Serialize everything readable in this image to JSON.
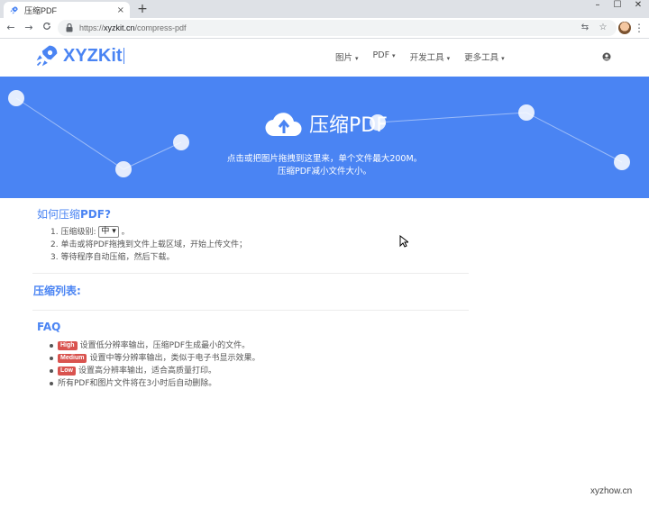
{
  "browser": {
    "tab_title": "压缩PDF",
    "tab_close": "×",
    "new_tab": "+",
    "window_controls": {
      "minimize": "–",
      "maximize": "☐",
      "close": "✕"
    },
    "nav": {
      "back": "←",
      "forward": "→",
      "reload": "C"
    },
    "url_scheme": "https://",
    "url_host": "xyzkit.cn",
    "url_path": "/compress-pdf",
    "omni_icons": [
      "translate-icon",
      "star-icon"
    ],
    "star": "☆",
    "translate": "⇆",
    "kebab": "⋮"
  },
  "site": {
    "logo_text": "XYZKit",
    "brand_color": "#4a84f3",
    "nav_items": [
      {
        "label": "图片"
      },
      {
        "label": "PDF"
      },
      {
        "label": "开发工具"
      },
      {
        "label": "更多工具"
      }
    ],
    "chevron": "⌄"
  },
  "hero": {
    "title": "压缩PDF",
    "line1": "点击或把图片拖拽到这里来，单个文件最大200M。",
    "line2": "压缩PDF减小文件大小。",
    "background": "#4a84f3"
  },
  "howto": {
    "title_prefix": "如何压缩",
    "title_bold": "PDF?",
    "step1_prefix": "1.  压缩级别: ",
    "level_selected": "中",
    "step1_suffix": " 。",
    "step2": "2.  单击或将PDF拖拽到文件上载区域，开始上传文件；",
    "step3": "3.  等待程序自动压缩，然后下载。"
  },
  "list": {
    "title": "压缩列表:"
  },
  "faq": {
    "title": "FAQ",
    "items": [
      {
        "badge": "High",
        "text": "设置低分辨率输出，压缩PDF生成最小的文件。"
      },
      {
        "badge": "Medium",
        "text": "设置中等分辨率输出，类似于电子书显示效果。"
      },
      {
        "badge": "Low",
        "text": "设置高分辨率输出，适合高质量打印。"
      },
      {
        "text": "所有PDF和图片文件将在3小时后自动删除。"
      }
    ],
    "badge_color": "#d9534f"
  },
  "watermark": "xyzhow.cn"
}
